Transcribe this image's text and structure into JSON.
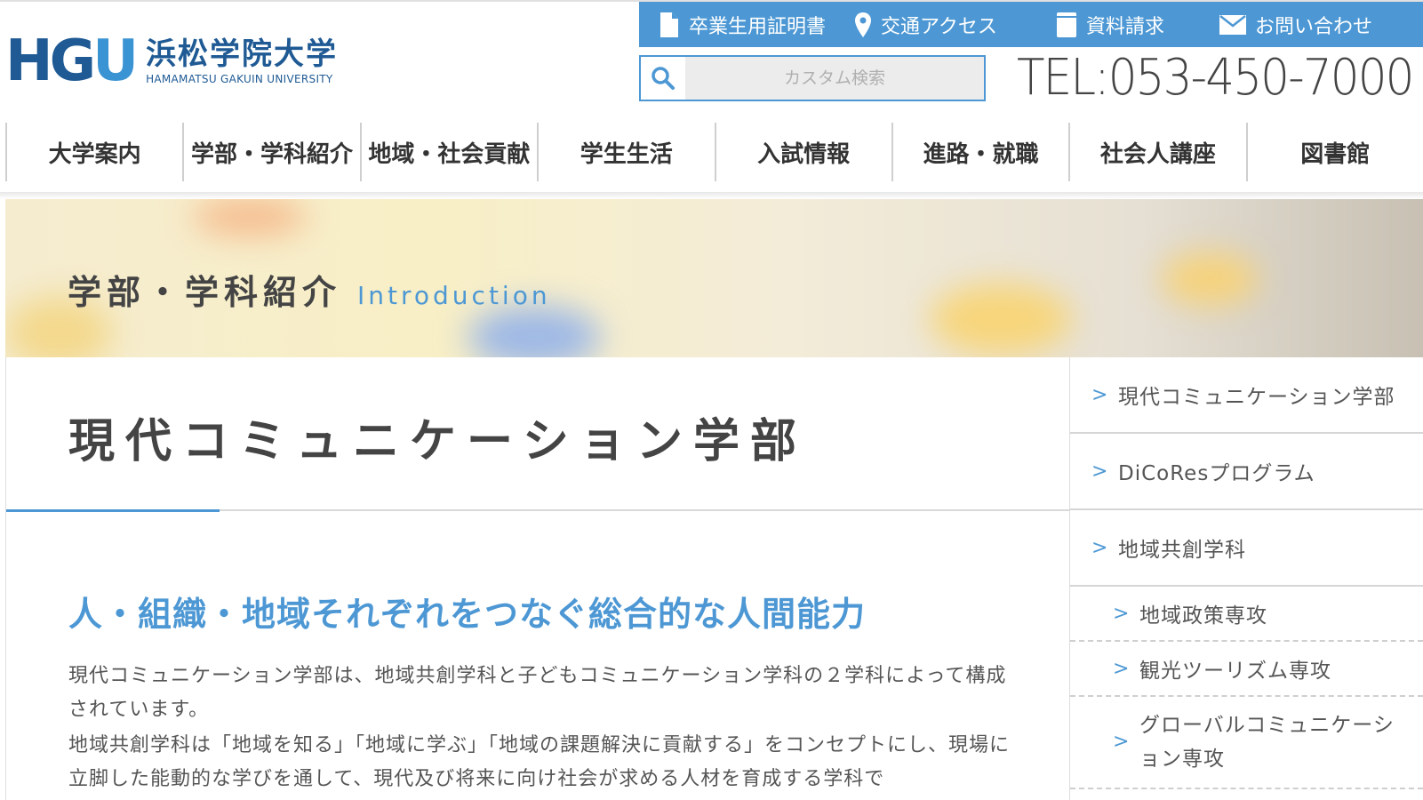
{
  "header": {
    "logo_mark_h": "H",
    "logo_mark_g": "G",
    "logo_mark_u": "U",
    "logo_jp": "浜松学院大学",
    "logo_en": "HAMAMATSU GAKUIN UNIVERSITY",
    "utility_links": [
      {
        "label": "卒業生用証明書",
        "icon": "document-icon"
      },
      {
        "label": "交通アクセス",
        "icon": "map-pin-icon"
      },
      {
        "label": "資料請求",
        "icon": "book-icon"
      },
      {
        "label": "お問い合わせ",
        "icon": "mail-icon"
      }
    ],
    "search_placeholder": "カスタム検索",
    "tel": "TEL:053-450-7000"
  },
  "gnav": [
    "大学案内",
    "学部・学科紹介",
    "地域・社会貢献",
    "学生生活",
    "入試情報",
    "進路・就職",
    "社会人講座",
    "図書館"
  ],
  "hero": {
    "title_jp": "学部・学科紹介",
    "title_en": "Introduction"
  },
  "main": {
    "page_title": "現代コミュニケーション学部",
    "section_heading": "人・組織・地域それぞれをつなぐ総合的な人間能力",
    "para1": "現代コミュニケーション学部は、地域共創学科と子どもコミュニケーション学科の２学科によって構成されています。",
    "para2": "地域共創学科は「地域を知る」「地域に学ぶ」「地域の課題解決に貢献する」をコンセプトにし、現場に立脚した能動的な学びを通して、現代及び将来に向け社会が求める人材を育成する学科で"
  },
  "sidenav": [
    {
      "label": "現代コミュニケーション学部",
      "sub": false
    },
    {
      "label": "DiCoResプログラム",
      "sub": false
    },
    {
      "label": "地域共創学科",
      "sub": false
    },
    {
      "label": "地域政策専攻",
      "sub": true
    },
    {
      "label": "観光ツーリズム専攻",
      "sub": true
    },
    {
      "label": "グローバルコミュニケーション専攻",
      "sub": true
    }
  ],
  "colors": {
    "accent": "#4d98d4",
    "brand_dark": "#1f5a94"
  }
}
